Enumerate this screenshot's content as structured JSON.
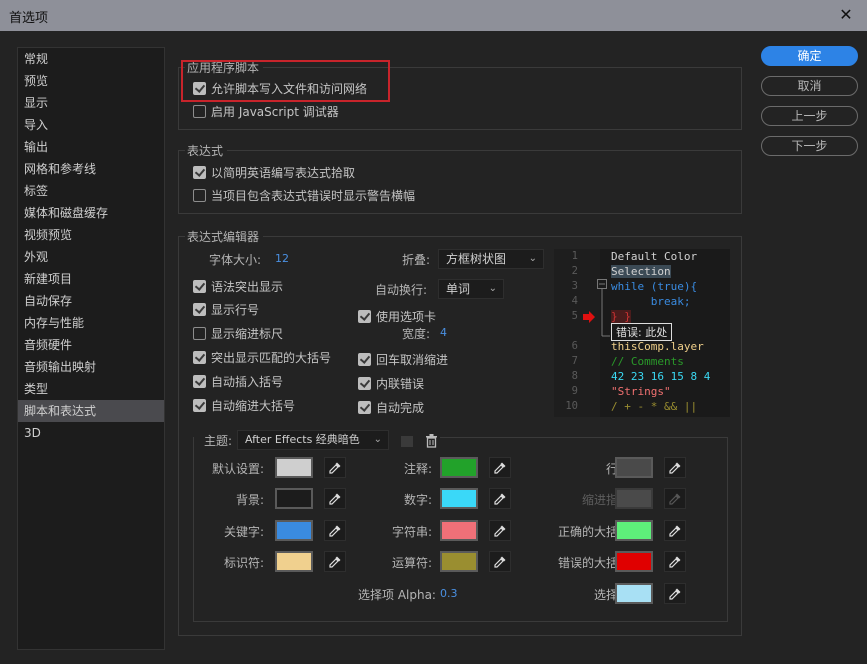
{
  "window": {
    "title": "首选项",
    "close_icon": "close-icon"
  },
  "sidebar": {
    "items": [
      {
        "label": "常规"
      },
      {
        "label": "预览"
      },
      {
        "label": "显示"
      },
      {
        "label": "导入"
      },
      {
        "label": "输出"
      },
      {
        "label": "网格和参考线"
      },
      {
        "label": "标签"
      },
      {
        "label": "媒体和磁盘缓存"
      },
      {
        "label": "视频预览"
      },
      {
        "label": "外观"
      },
      {
        "label": "新建项目"
      },
      {
        "label": "自动保存"
      },
      {
        "label": "内存与性能"
      },
      {
        "label": "音频硬件"
      },
      {
        "label": "音频输出映射"
      },
      {
        "label": "类型"
      },
      {
        "label": "脚本和表达式",
        "active": true
      },
      {
        "label": "3D"
      }
    ]
  },
  "buttons": {
    "ok": "确定",
    "cancel": "取消",
    "prev": "上一步",
    "next": "下一步"
  },
  "app_scripts": {
    "title": "应用程序脚本",
    "allow_write": {
      "label": "允许脚本写入文件和访问网络",
      "checked": true
    },
    "js_debugger": {
      "label": "启用 JavaScript 调试器",
      "checked": false
    }
  },
  "expressions": {
    "title": "表达式",
    "plain_english": {
      "label": "以简明英语编写表达式拾取",
      "checked": true
    },
    "warning_banner": {
      "label": "当项目包含表达式错误时显示警告横幅",
      "checked": false
    }
  },
  "editor": {
    "title": "表达式编辑器",
    "font_size_label": "字体大小:",
    "font_size_value": "12",
    "fold_label": "折叠:",
    "fold_value": "方框树状图",
    "wrap_label": "自动换行:",
    "wrap_value": "单词",
    "tab_width_label": "宽度:",
    "tab_width_value": "4",
    "left_checks": [
      {
        "label": "语法突出显示",
        "checked": true
      },
      {
        "label": "显示行号",
        "checked": true
      },
      {
        "label": "显示缩进标尺",
        "checked": false
      },
      {
        "label": "突出显示匹配的大括号",
        "checked": true
      },
      {
        "label": "自动插入括号",
        "checked": true
      },
      {
        "label": "自动缩进大括号",
        "checked": true
      }
    ],
    "right_checks": [
      {
        "label": "使用选项卡",
        "checked": true
      },
      {
        "label": "回车取消缩进",
        "checked": true
      },
      {
        "label": "内联错误",
        "checked": true
      },
      {
        "label": "自动完成",
        "checked": true
      }
    ],
    "preview": {
      "line_numbers": [
        "1",
        "2",
        "3",
        "4",
        "5",
        "6",
        "7",
        "8",
        "9",
        "10"
      ],
      "lines": [
        {
          "text": "Default Color",
          "color": "#d2d2d2"
        },
        {
          "text": "Selection",
          "color": "#d2d2d2",
          "bg": "#3b4a55"
        },
        {
          "text": "while (true){",
          "color": "#3a8be0"
        },
        {
          "text": "      break;",
          "color": "#3a8be0"
        },
        {
          "text": "} }",
          "color": "#cc3333"
        },
        {
          "text": "错误: 此处",
          "color": "#e0e0e0"
        },
        {
          "text": "thisComp.layer",
          "color": "#f0d08a"
        },
        {
          "text": "// Comments",
          "color": "#2a9a2a"
        },
        {
          "text": "42 23 16 15 8 4",
          "color": "#3ad8f2"
        },
        {
          "text": "\"Strings\"",
          "color": "#f07070"
        },
        {
          "text": "/ + - * && ||",
          "color": "#9a8e30"
        }
      ]
    }
  },
  "theme": {
    "label": "主题:",
    "value": "After Effects 经典暗色",
    "save_icon": "save-theme-icon",
    "delete_icon": "trash-icon",
    "colors": [
      {
        "label": "默认设置:",
        "hex": "#cfcfcf"
      },
      {
        "label": "背景:",
        "hex": "#1c1c1c"
      },
      {
        "label": "关键字:",
        "hex": "#3a8be0"
      },
      {
        "label": "标识符:",
        "hex": "#f0d08e"
      },
      {
        "label": "注释:",
        "hex": "#22a22a"
      },
      {
        "label": "数字:",
        "hex": "#3ad8f8"
      },
      {
        "label": "字符串:",
        "hex": "#f07078"
      },
      {
        "label": "运算符:",
        "hex": "#9a8e30"
      },
      {
        "label": "行号:",
        "hex": "#4a4a4a"
      },
      {
        "label": "缩进指示:",
        "hex": "#4a4a4a",
        "disabled": true
      },
      {
        "label": "正确的大括号:",
        "hex": "#5ef07a"
      },
      {
        "label": "错误的大括号:",
        "hex": "#e00000"
      },
      {
        "label": "选择项:",
        "hex": "#a8e0f4"
      }
    ],
    "alpha_label": "选择项 Alpha:",
    "alpha_value": "0.3"
  }
}
